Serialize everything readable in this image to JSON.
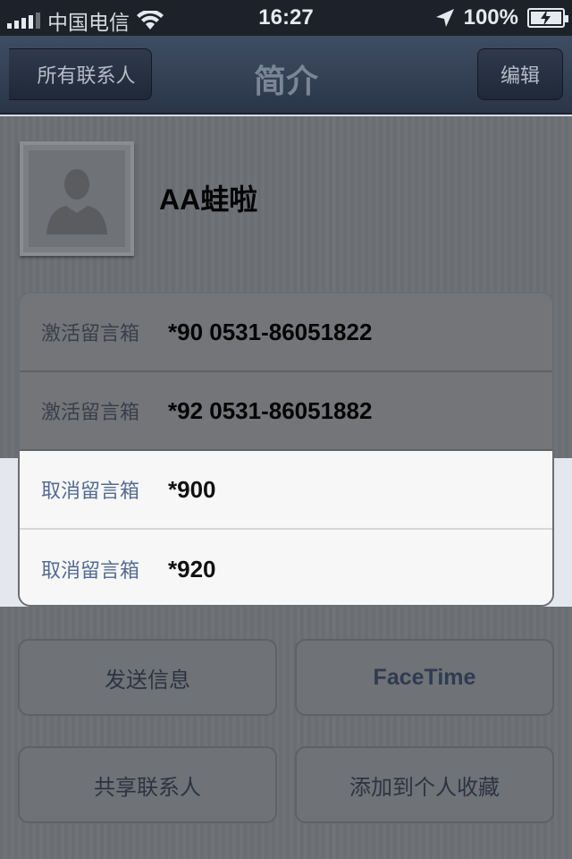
{
  "status_bar": {
    "carrier": "中国电信",
    "time": "16:27",
    "battery": "100%"
  },
  "nav": {
    "back_label": "所有联系人",
    "title": "简介",
    "edit_label": "编辑"
  },
  "contact": {
    "name": "AA蛙啦"
  },
  "phones": [
    {
      "label": "激活留言箱",
      "value": "*90 0531-86051822"
    },
    {
      "label": "激活留言箱",
      "value": "*92 0531-86051882"
    },
    {
      "label": "取消留言箱",
      "value": "*900"
    },
    {
      "label": "取消留言箱",
      "value": "*920"
    }
  ],
  "actions": {
    "send_message": "发送信息",
    "facetime": "FaceTime",
    "share_contact": "共享联系人",
    "add_favorite": "添加到个人收藏"
  }
}
